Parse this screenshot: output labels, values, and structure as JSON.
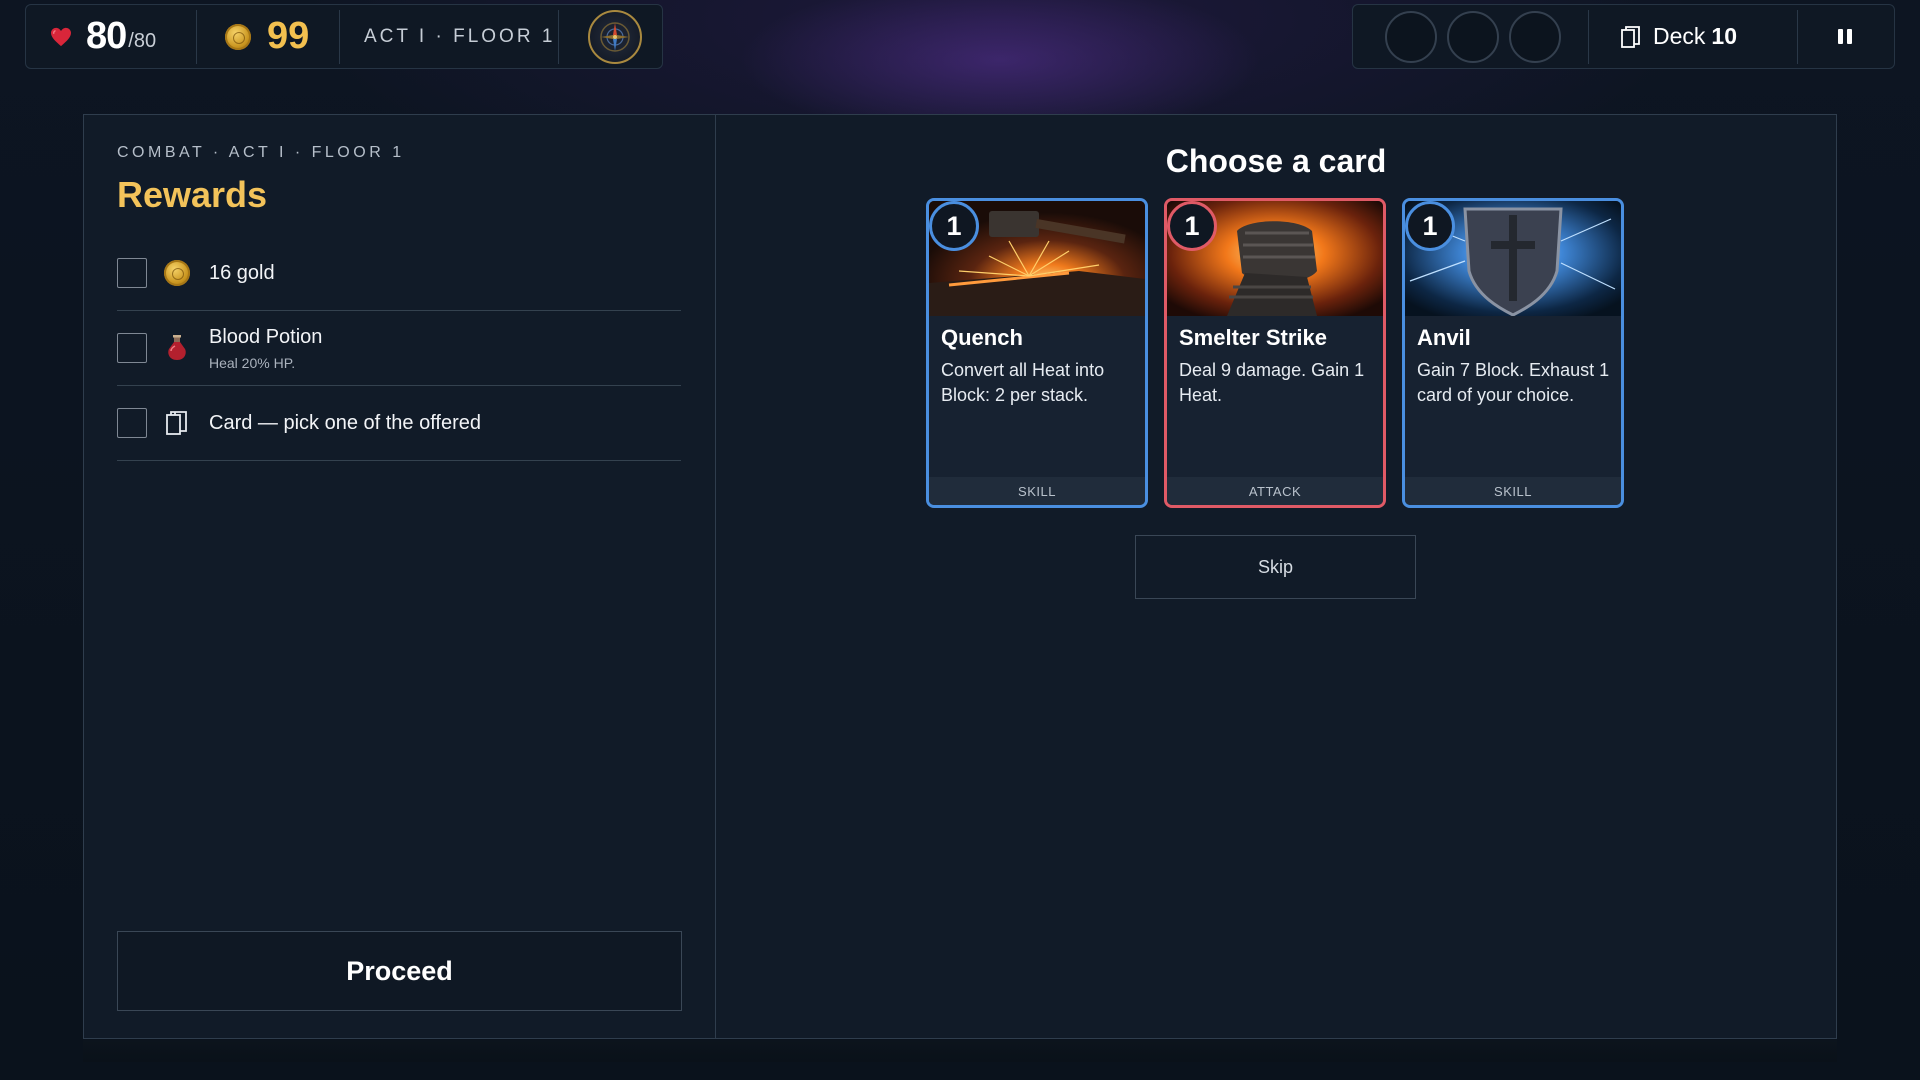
{
  "hud": {
    "hp_current": "80",
    "hp_max": "/80",
    "gold": "99",
    "location": "ACT I · FLOOR 1",
    "potion_slots": 3,
    "deck_label": "Deck",
    "deck_count": "10"
  },
  "rewards": {
    "breadcrumb": "COMBAT · ACT I · FLOOR 1",
    "title": "Rewards",
    "items": [
      {
        "name": "16 gold",
        "icon": "coin-icon"
      },
      {
        "name": "Blood Potion",
        "sub": "Heal 20% HP.",
        "icon": "potion-icon"
      },
      {
        "name": "Card — pick one of the offered",
        "icon": "cards-icon"
      }
    ],
    "proceed_label": "Proceed"
  },
  "card_choice": {
    "title": "Choose a card",
    "skip_label": "Skip",
    "cards": [
      {
        "cost": "1",
        "name": "Quench",
        "desc": "Convert all Heat into Block: 2 per stack.",
        "type": "SKILL",
        "color": "#4a8fe0"
      },
      {
        "cost": "1",
        "name": "Smelter Strike",
        "desc": "Deal 9 damage. Gain 1 Heat.",
        "type": "ATTACK",
        "color": "#e05a66"
      },
      {
        "cost": "1",
        "name": "Anvil",
        "desc": "Gain 7 Block. Exhaust 1 card of your choice.",
        "type": "SKILL",
        "color": "#4a8fe0"
      }
    ]
  },
  "colors": {
    "gold_accent": "#f3c35a",
    "skill_border": "#4a8fe0",
    "attack_border": "#e05a66"
  }
}
